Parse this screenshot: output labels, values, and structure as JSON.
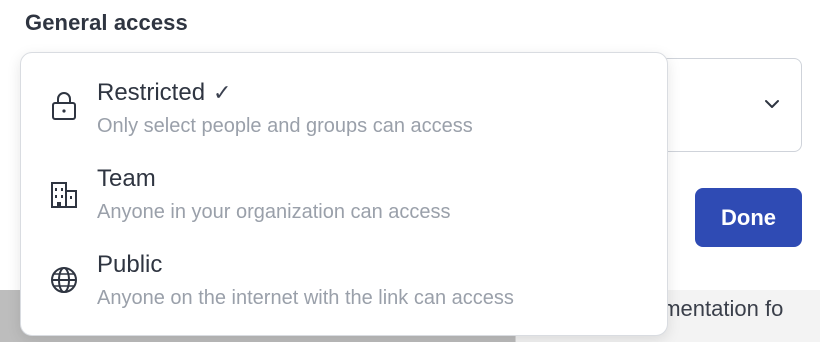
{
  "section": {
    "title": "General access"
  },
  "background": {
    "partial_text": "ementation fo"
  },
  "select": {
    "icon": "chevron-down-icon"
  },
  "done_button": {
    "label": "Done",
    "color": "#2f4bb4"
  },
  "dropdown": {
    "options": [
      {
        "label": "Restricted",
        "selected": true,
        "check": "✓",
        "description": "Only select people and groups can access",
        "icon": "lock-icon"
      },
      {
        "label": "Team",
        "selected": false,
        "description": "Anyone in your organization can access",
        "icon": "building-icon"
      },
      {
        "label": "Public",
        "selected": false,
        "description": "Anyone on the internet with the link can access",
        "icon": "globe-icon"
      }
    ]
  }
}
